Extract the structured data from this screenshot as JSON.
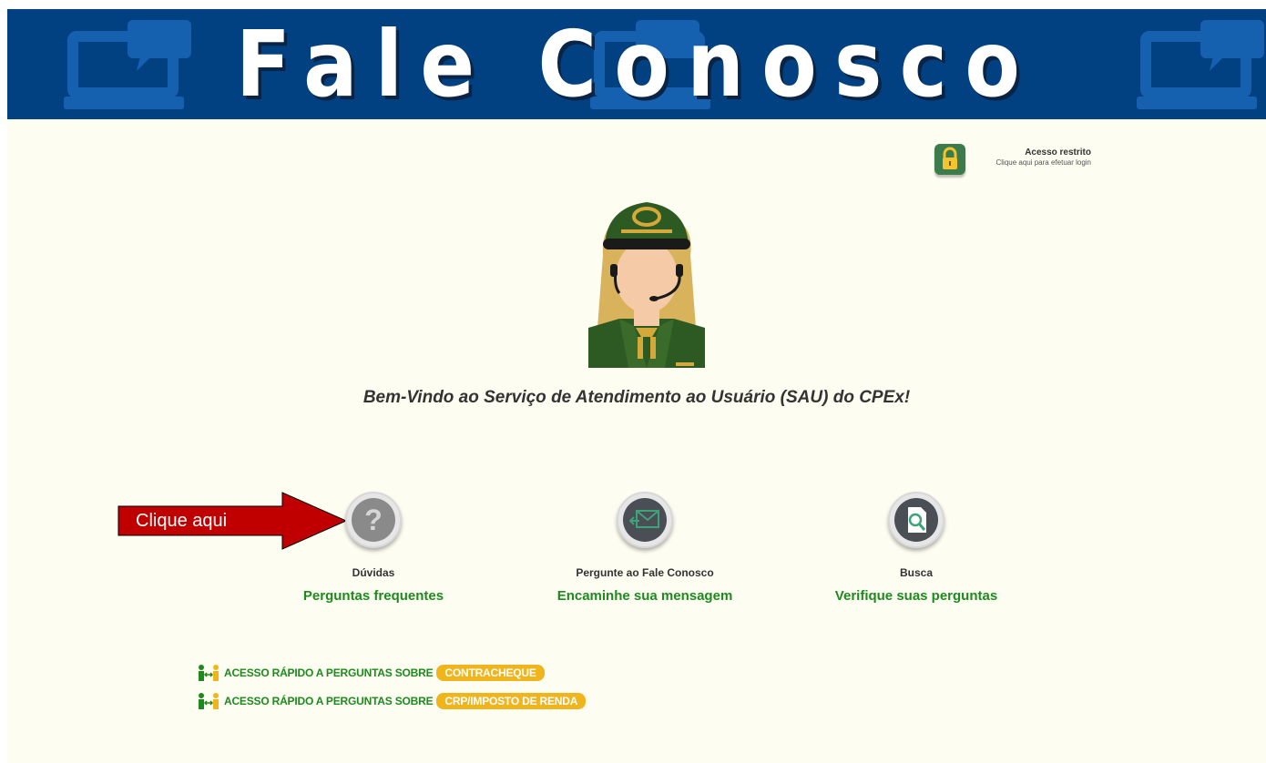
{
  "header": {
    "title": "Fale Conosco"
  },
  "access": {
    "title": "Acesso restrito",
    "subtitle": "Clique aqui para efetuar login"
  },
  "welcome": "Bem-Vindo ao Serviço de Atendimento ao Usuário (SAU) do CPEx!",
  "arrow_label": "Clique aqui",
  "options": [
    {
      "caption": "Dúvidas",
      "link": "Perguntas frequentes",
      "icon": "question-icon"
    },
    {
      "caption": "Pergunte ao Fale Conosco",
      "link": "Encaminhe sua mensagem",
      "icon": "message-icon"
    },
    {
      "caption": "Busca",
      "link": "Verifique suas perguntas",
      "icon": "search-icon"
    }
  ],
  "quick_links": [
    {
      "text": "ACESSO RÁPIDO A PERGUNTAS SOBRE",
      "badge": "CONTRACHEQUE"
    },
    {
      "text": "ACESSO RÁPIDO A PERGUNTAS SOBRE",
      "badge": "CRP/IMPOSTO DE RENDA"
    }
  ],
  "colors": {
    "banner": "#024181",
    "link_green": "#1e8a1e",
    "badge_yellow": "#f0b51c",
    "arrow_red": "#c00000"
  }
}
